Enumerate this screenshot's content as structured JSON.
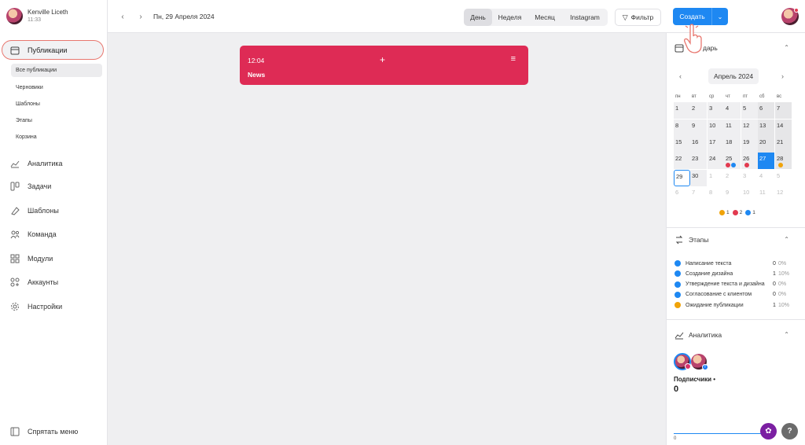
{
  "profile": {
    "name": "Kenville Liceth",
    "time": "11:33"
  },
  "sidebar": {
    "publications": "Публикации",
    "sub_items": [
      "Все публикации",
      "Черновики",
      "Шаблоны",
      "Этапы",
      "Корзина"
    ],
    "nav": [
      {
        "label": "Аналитика",
        "icon": "analytics-icon"
      },
      {
        "label": "Задачи",
        "icon": "tasks-icon"
      },
      {
        "label": "Шаблоны",
        "icon": "templates-icon"
      },
      {
        "label": "Команда",
        "icon": "team-icon"
      },
      {
        "label": "Модули",
        "icon": "modules-icon"
      },
      {
        "label": "Аккаунты",
        "icon": "accounts-icon"
      },
      {
        "label": "Настройки",
        "icon": "settings-icon"
      }
    ],
    "collapse": "Спрятать меню"
  },
  "topbar": {
    "date": "Пн, 29 Апреля 2024",
    "views": [
      "День",
      "Неделя",
      "Месяц",
      "Instagram"
    ],
    "active_view": "День",
    "filter": "Фильтр",
    "create": "Создать"
  },
  "event": {
    "time": "12:04",
    "title": "News",
    "color": "#de2b55"
  },
  "calendar": {
    "title": "Календарь",
    "visible_title": "дарь",
    "month": "Апрель 2024",
    "dow": [
      "пн",
      "вт",
      "ср",
      "чт",
      "пт",
      "сб",
      "вс"
    ],
    "weeks": [
      [
        "1",
        "2",
        "3",
        "4",
        "5",
        "6",
        "7"
      ],
      [
        "8",
        "9",
        "10",
        "11",
        "12",
        "13",
        "14"
      ],
      [
        "15",
        "16",
        "17",
        "18",
        "19",
        "20",
        "21"
      ],
      [
        "22",
        "23",
        "24",
        "25",
        "26",
        "27",
        "28"
      ],
      [
        "29",
        "30",
        "1",
        "2",
        "3",
        "4",
        "5"
      ],
      [
        "6",
        "7",
        "8",
        "9",
        "10",
        "11",
        "12"
      ]
    ],
    "legend": [
      {
        "count": "1",
        "color": "#f0a30a"
      },
      {
        "count": "2",
        "color": "#e23a4f"
      },
      {
        "count": "1",
        "color": "#1e88f2"
      }
    ]
  },
  "stages": {
    "title": "Этапы",
    "items": [
      {
        "label": "Написание текста",
        "count": "0",
        "pct": "0%",
        "color": "#1e88f2"
      },
      {
        "label": "Создание дизайна",
        "count": "1",
        "pct": "10%",
        "color": "#1e88f2"
      },
      {
        "label": "Утверждение текста и дизайна",
        "count": "0",
        "pct": "0%",
        "color": "#1e88f2"
      },
      {
        "label": "Согласование с клиентом",
        "count": "0",
        "pct": "0%",
        "color": "#1e88f2"
      },
      {
        "label": "Ожидание публикации",
        "count": "1",
        "pct": "10%",
        "color": "#f0a30a"
      }
    ]
  },
  "analytics": {
    "title": "Аналитика",
    "subscribers_label": "Подписчики •",
    "subscribers_value": "0",
    "axis_zero": "0"
  },
  "fab": {
    "help": "?"
  }
}
